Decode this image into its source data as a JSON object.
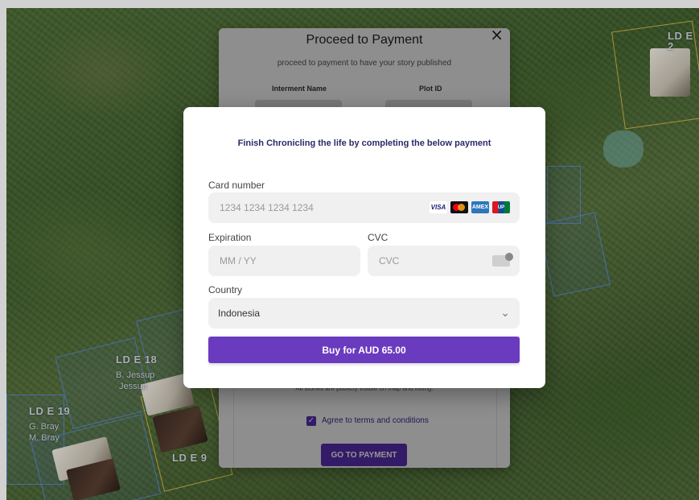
{
  "map": {
    "labels": {
      "top_right": "LD E 2",
      "plot_e18": "LD E 18",
      "plot_e18_name1": "B. Jessup",
      "plot_e18_name2": "Jessup",
      "plot_e19": "LD E 19",
      "plot_e19_name1": "G. Bray",
      "plot_e19_name2": "M. Bray",
      "plot_e9": "LD E 9"
    }
  },
  "back_modal": {
    "close_glyph": "×",
    "title": "Proceed to Payment",
    "subtitle": "proceed to payment to have your story published",
    "interment_label": "Interment Name",
    "plot_id_label": "Plot ID",
    "note": "All stories are publicly visible on map and listing.",
    "checkbox_checked": true,
    "terms_label": "Agree to terms and conditions",
    "go_button": "GO TO PAYMENT"
  },
  "payment": {
    "heading": "Finish Chronicling the life by completing the below payment",
    "card_number_label": "Card number",
    "card_number_placeholder": "1234 1234 1234 1234",
    "card_brands": [
      "visa-icon",
      "mastercard-icon",
      "amex-icon",
      "unionpay-icon"
    ],
    "visa_text": "VISA",
    "amex_text": "AMEX",
    "unionpay_text": "UP",
    "expiration_label": "Expiration",
    "expiration_placeholder": "MM / YY",
    "cvc_label": "CVC",
    "cvc_placeholder": "CVC",
    "country_label": "Country",
    "country_value": "Indonesia",
    "buy_button": "Buy for AUD 65.00"
  },
  "colors": {
    "accent": "#6a3bbf",
    "heading": "#2a2a6a"
  }
}
